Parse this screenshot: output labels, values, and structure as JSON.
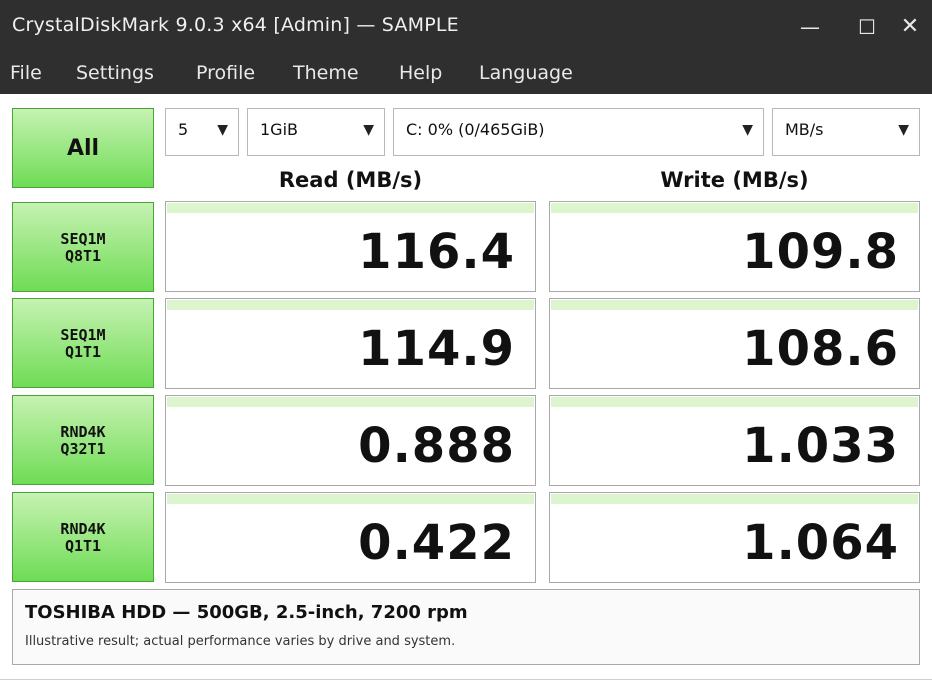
{
  "window": {
    "title": "CrystalDiskMark 9.0.3 x64 [Admin] — SAMPLE",
    "minimize_glyph": "—",
    "maximize_glyph": "☐",
    "close_glyph": "✕"
  },
  "menu": [
    "File",
    "Settings",
    "Profile",
    "Theme",
    "Help",
    "Language"
  ],
  "controls": {
    "all_label": "All",
    "count": "5",
    "size": "1GiB",
    "drive": "C: 0% (0/465GiB)",
    "unit": "MB/s",
    "dropdown_arrow": "▼"
  },
  "headers": {
    "read": "Read (MB/s)",
    "write": "Write (MB/s)"
  },
  "tests": [
    {
      "line1": "SEQ1M",
      "line2": "Q8T1",
      "read": "116.4",
      "write": "109.8"
    },
    {
      "line1": "SEQ1M",
      "line2": "Q1T1",
      "read": "114.9",
      "write": "108.6"
    },
    {
      "line1": "RND4K",
      "line2": "Q32T1",
      "read": "0.888",
      "write": "1.033"
    },
    {
      "line1": "RND4K",
      "line2": "Q1T1",
      "read": "0.422",
      "write": "1.064"
    }
  ],
  "info": {
    "drive_name": "TOSHIBA HDD — 500GB, 2.5-inch, 7200 rpm",
    "note": "Illustrative result; actual performance varies by drive and system."
  },
  "colors": {
    "accent_green": "#6fdc55",
    "bar_green": "#ddf5cf",
    "titlebar": "#2f2f2f"
  }
}
